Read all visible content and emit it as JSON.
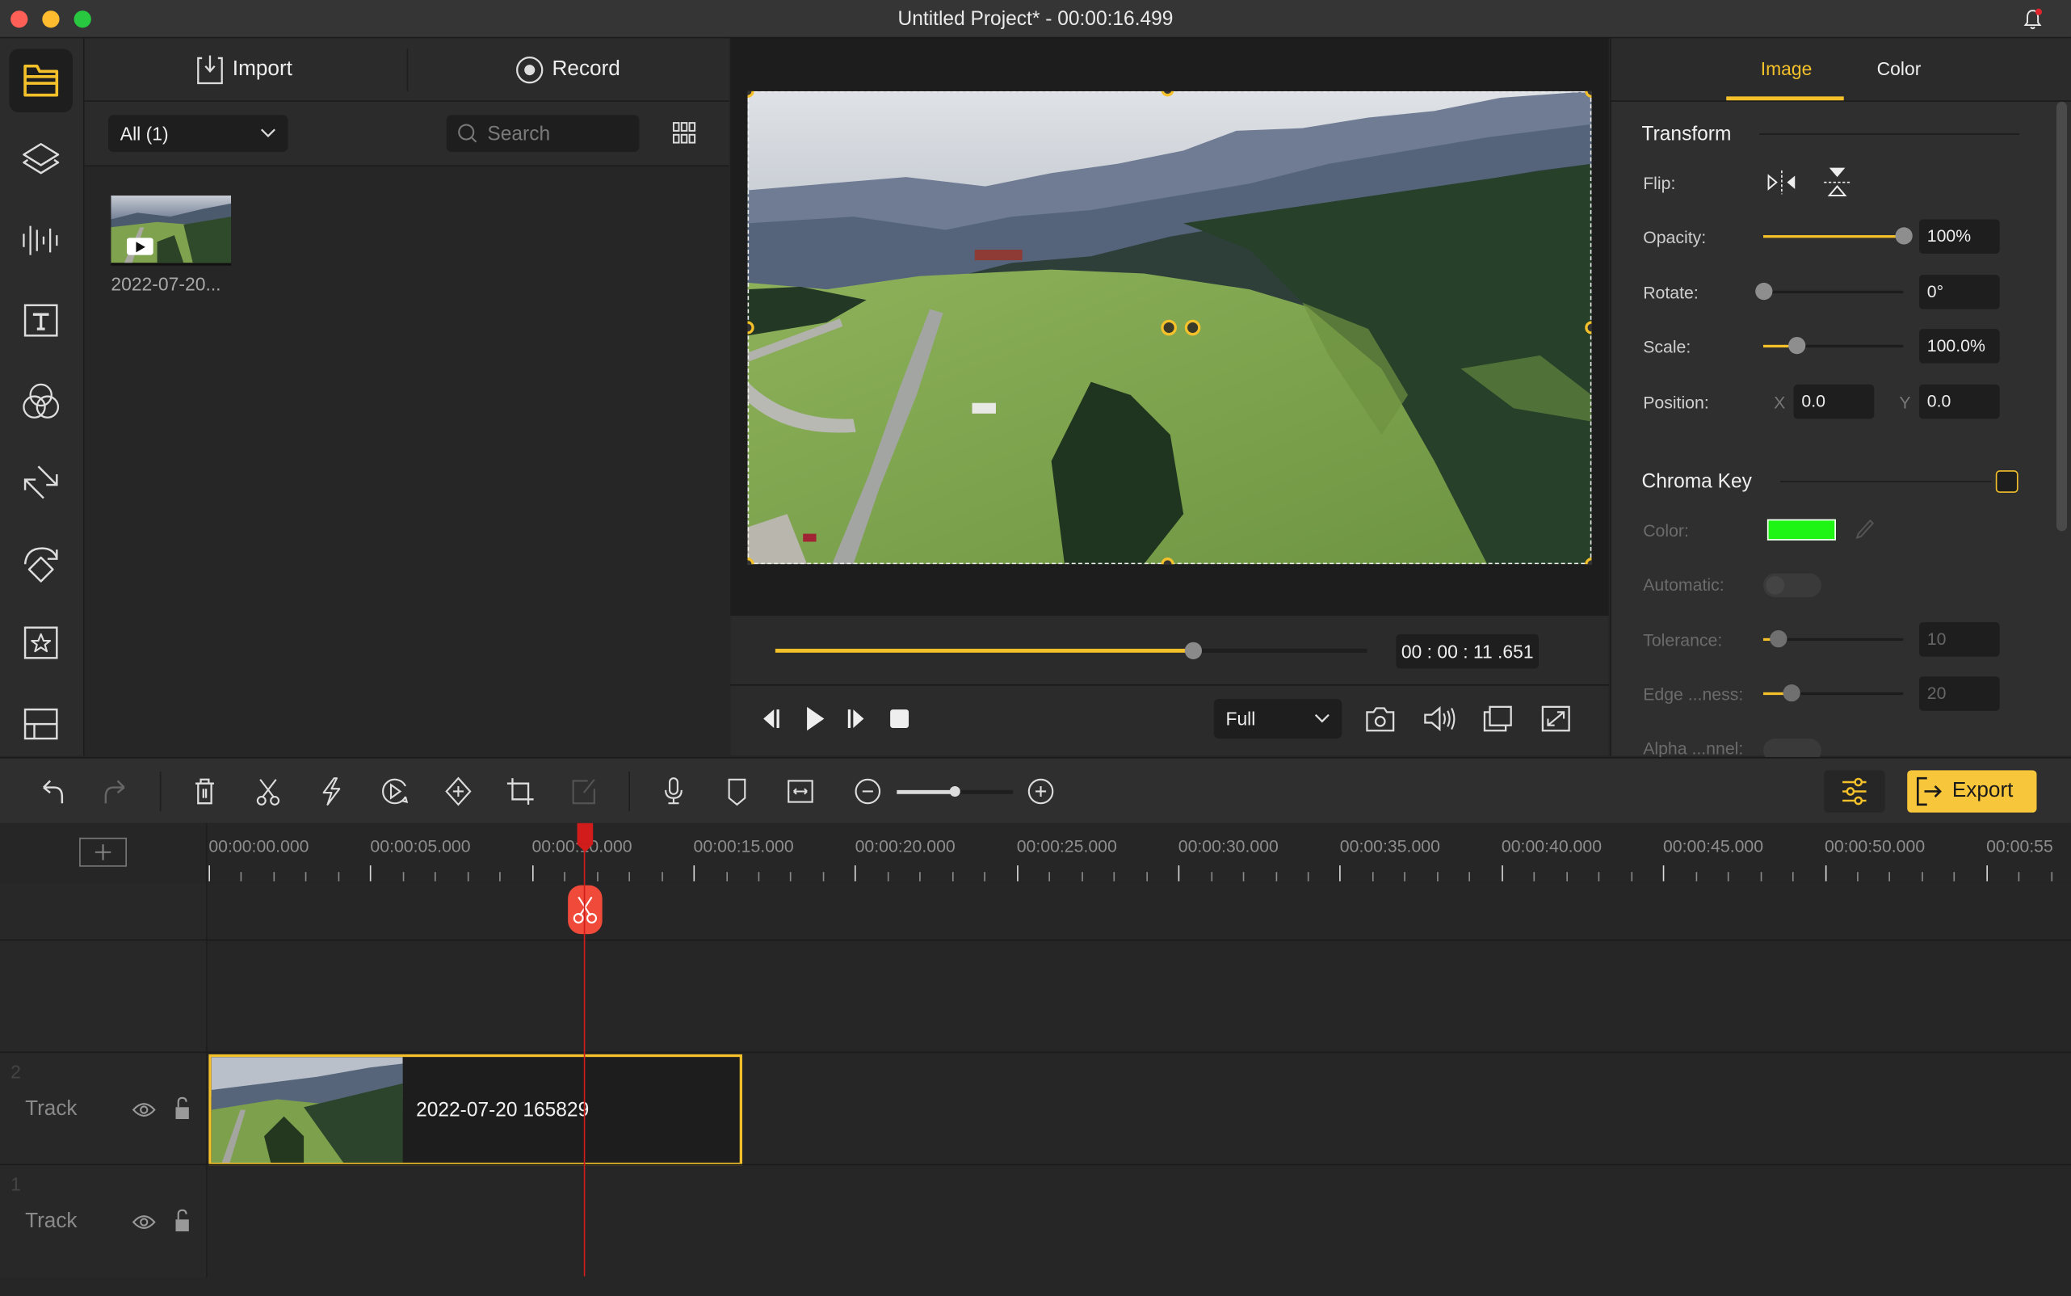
{
  "window": {
    "title": "Untitled Project* - 00:00:16.499",
    "traffic_lights": [
      "close",
      "minimize",
      "maximize"
    ],
    "notification_icon": "bell-icon",
    "has_notification": true
  },
  "sidebar": {
    "items": [
      {
        "name": "media",
        "icon": "folder-icon",
        "active": true
      },
      {
        "name": "layers",
        "icon": "layers-icon",
        "active": false
      },
      {
        "name": "audio",
        "icon": "waveform-icon",
        "active": false
      },
      {
        "name": "text",
        "icon": "text-icon",
        "active": false
      },
      {
        "name": "filters",
        "icon": "filters-icon",
        "active": false
      },
      {
        "name": "transitions",
        "icon": "transition-arrows-icon",
        "active": false
      },
      {
        "name": "animations",
        "icon": "rotate-diamond-icon",
        "active": false
      },
      {
        "name": "stickers",
        "icon": "star-frame-icon",
        "active": false
      },
      {
        "name": "templates",
        "icon": "layout-icon",
        "active": false
      }
    ]
  },
  "media": {
    "import_label": "Import",
    "record_label": "Record",
    "filter_value": "All (1)",
    "search_placeholder": "Search",
    "items": [
      {
        "label": "2022-07-20...",
        "type": "video"
      }
    ]
  },
  "preview": {
    "progress_fraction": 0.705,
    "timecode": "00 : 00 : 11 .651",
    "quality_value": "Full"
  },
  "properties": {
    "tabs": [
      {
        "label": "Image",
        "active": true
      },
      {
        "label": "Color",
        "active": false
      }
    ],
    "transform": {
      "title": "Transform",
      "flip_label": "Flip:",
      "opacity_label": "Opacity:",
      "opacity_value": "100%",
      "opacity_fraction": 1.0,
      "rotate_label": "Rotate:",
      "rotate_value": "0°",
      "rotate_fraction": 0.0,
      "scale_label": "Scale:",
      "scale_value": "100.0%",
      "scale_fraction": 0.24,
      "position_label": "Position:",
      "x_label": "X",
      "x_value": "0.0",
      "y_label": "Y",
      "y_value": "0.0"
    },
    "chroma_key": {
      "title": "Chroma Key",
      "enabled": false,
      "color_label": "Color:",
      "color_value": "#1ff515",
      "automatic_label": "Automatic:",
      "automatic_on": false,
      "tolerance_label": "Tolerance:",
      "tolerance_value": "10",
      "tolerance_fraction": 0.1,
      "edge_label": "Edge ...ness:",
      "edge_value": "20",
      "edge_fraction": 0.2,
      "alpha_label": "Alpha ...nnel:"
    }
  },
  "toolbar": {
    "tools": [
      "undo",
      "redo",
      "delete",
      "split",
      "speed",
      "reverse",
      "keyframe",
      "crop",
      "edit"
    ],
    "export_label": "Export"
  },
  "timeline": {
    "ruler_labels": [
      "00:00:00.000",
      "00:00:05.000",
      "00:00:10.000",
      "00:00:15.000",
      "00:00:20.000",
      "00:00:25.000",
      "00:00:30.000",
      "00:00:35.000",
      "00:00:40.000",
      "00:00:45.000",
      "00:00:50.000",
      "00:00:55"
    ],
    "playhead_seconds": 11.65,
    "tracks": [
      {
        "number": "2",
        "name": "Track",
        "clip": {
          "label": "2022-07-20 165829",
          "start_seconds": 0,
          "end_seconds": 16.5
        }
      },
      {
        "number": "1",
        "name": "Track"
      }
    ]
  },
  "colors": {
    "accent": "#f5c12a",
    "playhead": "#d21c1c",
    "split_marker": "#f04a3a"
  }
}
